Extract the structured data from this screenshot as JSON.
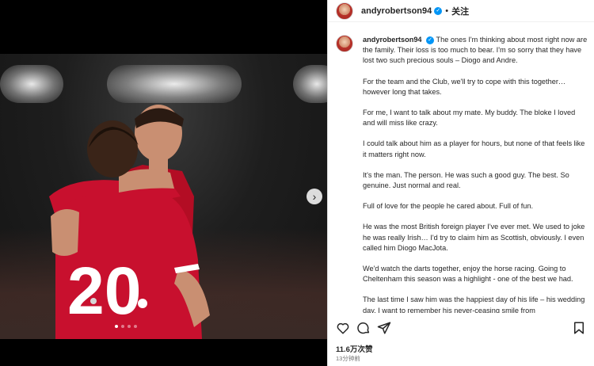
{
  "post": {
    "username": "andyrobertson94",
    "separator": "•",
    "follow_label": "关注",
    "jersey_number": "20"
  },
  "caption": {
    "paragraphs": [
      "The ones I'm thinking about most right now are the family. Their loss is too much to bear. I'm so sorry that they have lost two such precious souls – Diogo and Andre.",
      "For the team and the Club, we'll try to cope with this together… however long that takes.",
      "For me, I want to talk about my mate. My buddy. The bloke I loved and will miss like crazy.",
      "I could talk about him as a player for hours, but none of that feels like it matters right now.",
      "It's the man. The person. He was such a good guy. The best. So genuine. Just normal and real.",
      "Full of love for the people he cared about. Full of fun.",
      "He was the most British foreign player I've ever met. We used to joke he was really Irish… I'd try to claim him as Scottish, obviously. I even called him Diogo MacJota.",
      "We'd watch the darts together, enjoy the horse racing. Going to Cheltenham this season was a highlight - one of the best we had.",
      "The last time I saw him was the happiest day of his life – his wedding day. I want to remember his never-ceasing smile from"
    ]
  },
  "stats": {
    "likes": "11.6万次赞",
    "time": "13分钟前"
  },
  "carousel": {
    "total": 4,
    "active": 1
  },
  "colors": {
    "verified": "#0095f6",
    "jersey_red": "#c8102e"
  }
}
